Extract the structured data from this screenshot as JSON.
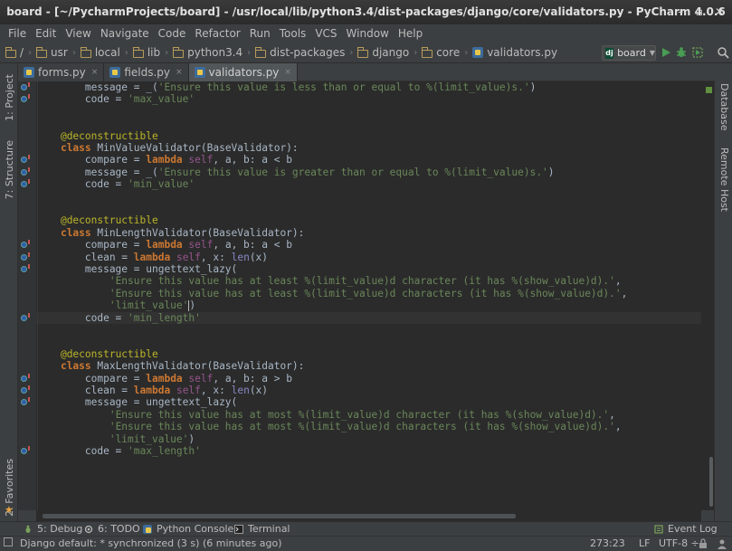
{
  "window": {
    "title": "board - [~/PycharmProjects/board] - /usr/local/lib/python3.4/dist-packages/django/core/validators.py - PyCharm 4.0.6",
    "controls": {
      "minimize": "–",
      "maximize": "▫",
      "close": "✕"
    }
  },
  "menu": [
    "File",
    "Edit",
    "View",
    "Navigate",
    "Code",
    "Refactor",
    "Run",
    "Tools",
    "VCS",
    "Window",
    "Help"
  ],
  "breadcrumbs": [
    "/",
    "usr",
    "local",
    "lib",
    "python3.4",
    "dist-packages",
    "django",
    "core",
    "validators.py"
  ],
  "run_config": {
    "label": "board",
    "badge": "dj"
  },
  "tabs": [
    {
      "label": "forms.py",
      "close": "×"
    },
    {
      "label": "fields.py",
      "close": "×"
    },
    {
      "label": "validators.py",
      "close": "×"
    }
  ],
  "left_tool_tabs": {
    "project": "1: Project",
    "structure": "7: Structure",
    "favorites": "2: Favorites"
  },
  "right_tool_tabs": {
    "database": "Database",
    "remote_host": "Remote Host"
  },
  "bottom_tools": {
    "debug": "5: Debug",
    "todo": "6: TODO",
    "python_console": "Python Console",
    "terminal": "Terminal",
    "event_log": "Event Log"
  },
  "status": {
    "message": "Django default: * synchronized (3 s) (6 minutes ago)",
    "position": "273:23",
    "line_sep": "LF",
    "encoding": "UTF-8 ÷"
  },
  "code_lines": [
    "        message = _('Ensure this value is less than or equal to %(limit_value)s.')",
    "        code = 'max_value'",
    "",
    "",
    "    @deconstructible",
    "    class MinValueValidator(BaseValidator):",
    "        compare = lambda self, a, b: a < b",
    "        message = _('Ensure this value is greater than or equal to %(limit_value)s.')",
    "        code = 'min_value'",
    "",
    "",
    "    @deconstructible",
    "    class MinLengthValidator(BaseValidator):",
    "        compare = lambda self, a, b: a < b",
    "        clean = lambda self, x: len(x)",
    "        message = ungettext_lazy(",
    "            'Ensure this value has at least %(limit_value)d character (it has %(show_value)d).',",
    "            'Ensure this value has at least %(limit_value)d characters (it has %(show_value)d).',",
    "            'limit_value')",
    "        code = 'min_length'",
    "",
    "",
    "    @deconstructible",
    "    class MaxLengthValidator(BaseValidator):",
    "        compare = lambda self, a, b: a > b",
    "        clean = lambda self, x: len(x)",
    "        message = ungettext_lazy(",
    "            'Ensure this value has at most %(limit_value)d character (it has %(show_value)d).',",
    "            'Ensure this value has at most %(limit_value)d characters (it has %(show_value)d).',",
    "            'limit_value')",
    "        code = 'max_length'"
  ],
  "current_line": 19,
  "gutter_override_lines": [
    0,
    1,
    6,
    7,
    8,
    13,
    14,
    15,
    19,
    24,
    25,
    26,
    30
  ],
  "colors": {
    "keyword": "#cc7832",
    "string": "#6a8759",
    "decorator": "#bbb529",
    "self": "#94558d",
    "builtin": "#8888c6",
    "text": "#a9b7c6",
    "background": "#2b2b2b"
  }
}
